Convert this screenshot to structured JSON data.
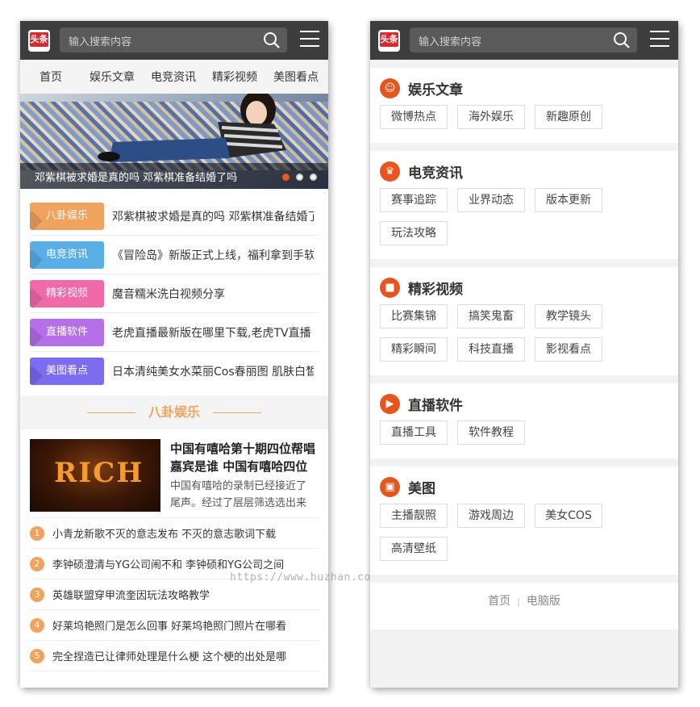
{
  "left": {
    "search_placeholder": "输入搜索内容",
    "logo_text": "头条",
    "nav": [
      "首页",
      "娱乐文章",
      "电竞资讯",
      "精彩视频",
      "美图看点"
    ],
    "banner_caption": "邓紫棋被求婚是真的吗 邓紫棋准备结婚了吗",
    "categories": [
      {
        "tag": "八卦娱乐",
        "color": "#f0a35f",
        "text": "邓紫棋被求婚是真的吗 邓紫棋准备结婚了吗"
      },
      {
        "tag": "电竞资讯",
        "color": "#5aaee8",
        "text": "《冒险岛》新版正式上线，福利拿到手软"
      },
      {
        "tag": "精彩视频",
        "color": "#f06aa7",
        "text": "魔音糯米洗白视频分享"
      },
      {
        "tag": "直播软件",
        "color": "#b56fe8",
        "text": "老虎直播最新版在哪里下载,老虎TV直播"
      },
      {
        "tag": "美图看点",
        "color": "#7b6cf0",
        "text": "日本清纯美女水菜丽Cos春丽图 肌肤白皙"
      }
    ],
    "section_title": "八卦娱乐",
    "featured": {
      "thumb_text": "RICH",
      "title": "中国有嘻哈第十期四位帮唱嘉宾是谁 中国有嘻哈四位帮唱嘉宾",
      "desc": "中国有嘻哈的录制已经接近了尾声。经过了层层筛选选出来的"
    },
    "list": [
      {
        "n": "1",
        "text": "小青龙新歌不灭的意志发布 不灭的意志歌词下载"
      },
      {
        "n": "2",
        "text": "李钟硕澄清与YG公司闹不和 李钟硕和YG公司之间"
      },
      {
        "n": "3",
        "text": "英雄联盟穿甲流奎因玩法攻略教学"
      },
      {
        "n": "4",
        "text": "好莱坞艳照门是怎么回事 好莱坞艳照门照片在哪看"
      },
      {
        "n": "5",
        "text": "完全捏造已让律师处理是什么梗 这个梗的出处是哪"
      }
    ],
    "watermark": "https://www.huzhan.com/ishop29163"
  },
  "right": {
    "search_placeholder": "输入搜索内容",
    "logo_text": "头条",
    "blocks": [
      {
        "title": "娱乐文章",
        "icon": "people-icon",
        "items": [
          "微博热点",
          "海外娱乐",
          "新趣原创"
        ]
      },
      {
        "title": "电竞资讯",
        "icon": "trophy-icon",
        "items": [
          "赛事追踪",
          "业界动态",
          "版本更新",
          "玩法攻略"
        ]
      },
      {
        "title": "精彩视频",
        "icon": "video-camera-icon",
        "items": [
          "比赛集锦",
          "搞笑鬼畜",
          "教学镜头",
          "精彩瞬间",
          "科技直播",
          "影视看点"
        ]
      },
      {
        "title": "直播软件",
        "icon": "play-icon",
        "items": [
          "直播工具",
          "软件教程"
        ]
      },
      {
        "title": "美图",
        "icon": "image-icon",
        "items": [
          "主播靓照",
          "游戏周边",
          "美女COS",
          "高清壁纸"
        ]
      }
    ],
    "footer": {
      "home": "首页",
      "divider": "|",
      "pc": "电脑版"
    }
  }
}
